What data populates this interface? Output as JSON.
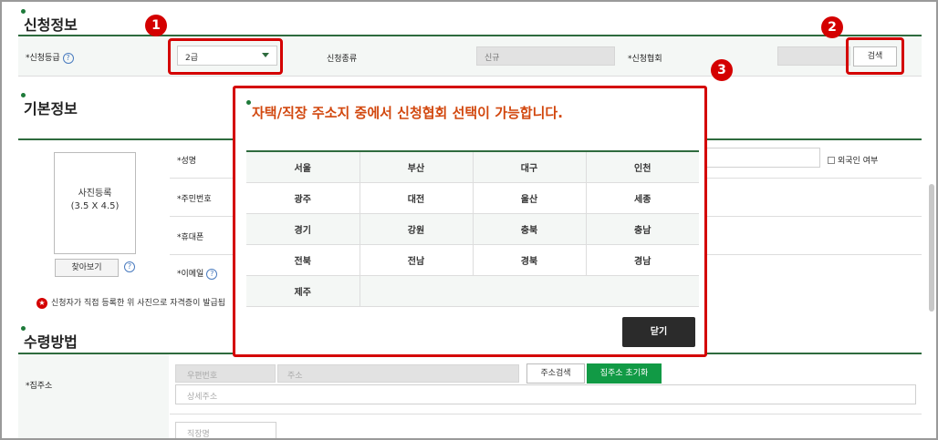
{
  "sections": {
    "apply_info": "신청정보",
    "basic_info": "기본정보",
    "receive_method": "수령방법"
  },
  "apply": {
    "grade_label": "신청등급",
    "grade_value": "2급",
    "type_label": "신청종류",
    "type_value": "신규",
    "assoc_label": "신청협회",
    "assoc_value": "",
    "search_button": "검색"
  },
  "basic": {
    "photo_text": "사진등록\n(3.5 X 4.5)",
    "photo_line1": "사진등록",
    "photo_line2": "(3.5 X 4.5)",
    "find_button": "찾아보기",
    "name_label": "성명",
    "ssn_label": "주민번호",
    "phone_label": "휴대폰",
    "email_label": "이메일",
    "foreigner_label": "외국인 여부",
    "notice": "신청자가 직접 등록한 위 사진으로 자격증이 발급됩"
  },
  "receive": {
    "address_label": "집주소",
    "zip_placeholder": "우편번호",
    "addr_placeholder": "주소",
    "addr_search_button": "주소검색",
    "addr_reset_button": "집주소 초기화",
    "detail_placeholder": "상세주소",
    "work_placeholder": "직장명"
  },
  "modal": {
    "title": "자택/직장 주소지 중에서 신청협회 선택이 가능합니다.",
    "regions": [
      [
        "서울",
        "부산",
        "대구",
        "인천"
      ],
      [
        "광주",
        "대전",
        "울산",
        "세종"
      ],
      [
        "경기",
        "강원",
        "충북",
        "충남"
      ],
      [
        "전북",
        "전남",
        "경북",
        "경남"
      ],
      [
        "제주"
      ]
    ],
    "close_button": "닫기"
  },
  "callouts": [
    "1",
    "2",
    "3"
  ],
  "colors": {
    "accent_green": "#1e7a3a",
    "callout_red": "#d40000",
    "title_orange": "#d2480f"
  }
}
